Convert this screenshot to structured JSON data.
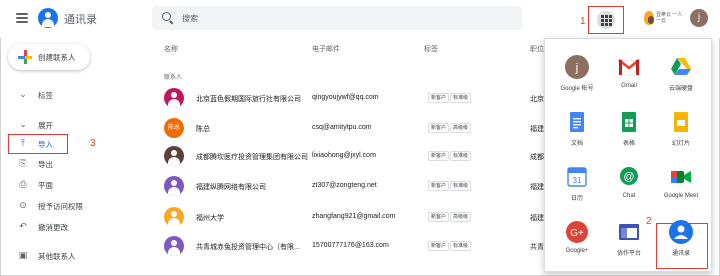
{
  "header": {
    "app_title": "通讯录",
    "search_placeholder": "搜索",
    "brand_text": "壹拳云 一人一云",
    "user_initial": "j",
    "steps": [
      "1",
      "2",
      "3"
    ]
  },
  "sidebar": {
    "create_label": "创建联系人",
    "items": [
      {
        "label": "标签",
        "icon": "chevron-down-icon"
      },
      {
        "label": "展开",
        "icon": "chevron-down-icon"
      },
      {
        "label": "导入",
        "icon": "upload-icon"
      },
      {
        "label": "导出",
        "icon": "download-icon"
      },
      {
        "label": "平面",
        "icon": "print-icon"
      },
      {
        "label": "授予访问权限",
        "icon": "delegate-icon"
      },
      {
        "label": "撤消更改",
        "icon": "undo-icon"
      },
      {
        "label": "其他联系人",
        "icon": "contacts-icon"
      }
    ]
  },
  "table": {
    "headers": [
      "名称",
      "电子邮件",
      "标签",
      "职位"
    ],
    "section_label": "联系人",
    "rows": [
      {
        "name": "北京蓝色假期国际旅行社有限公司",
        "email": "qingyoujywf@qq.com",
        "tags": [
          "新客户",
          "标准级"
        ],
        "job": "北京",
        "avatar_text": "",
        "avatar_color": "#c2185b"
      },
      {
        "name": "陈总",
        "email": "csq@amitytpu.com",
        "tags": [
          "新客户",
          "高级级"
        ],
        "job": "福建",
        "avatar_text": "陈总",
        "avatar_color": "#ef6c00"
      },
      {
        "name": "成都腾坎医疗投资管理集团有限公司",
        "email": "lixiaohong@jxyl.com",
        "tags": [
          "新客户",
          "标准级"
        ],
        "job": "成都",
        "avatar_text": "",
        "avatar_color": "#5d4037"
      },
      {
        "name": "福建纵腾网络有限公司",
        "email": "zt307@zongteng.net",
        "tags": [
          "新客户",
          "标准级"
        ],
        "job": "福建",
        "avatar_text": "",
        "avatar_color": "#7e57c2"
      },
      {
        "name": "福州大学",
        "email": "zhangfang921@gmail.com",
        "tags": [
          "新客户",
          "高级级"
        ],
        "job": "福建",
        "avatar_text": "",
        "avatar_color": "#f9a825"
      },
      {
        "name": "共青城赤兔投资管理中心（有限...",
        "email": "15700777176@163.com",
        "tags": [
          "新客户",
          "标准级"
        ],
        "job": "共青",
        "avatar_text": "",
        "avatar_color": "#7e57c2"
      }
    ]
  },
  "apps": [
    {
      "label": "Google 帐号",
      "icon": "google-account-icon"
    },
    {
      "label": "Gmail",
      "icon": "gmail-icon"
    },
    {
      "label": "云端硬盘",
      "icon": "drive-icon"
    },
    {
      "label": "文档",
      "icon": "docs-icon"
    },
    {
      "label": "表格",
      "icon": "sheets-icon"
    },
    {
      "label": "幻灯片",
      "icon": "slides-icon"
    },
    {
      "label": "日历",
      "icon": "calendar-icon"
    },
    {
      "label": "Chat",
      "icon": "chat-icon"
    },
    {
      "label": "Google Meet",
      "icon": "meet-icon"
    },
    {
      "label": "Google+",
      "icon": "google-plus-icon"
    },
    {
      "label": "协作平台",
      "icon": "sites-icon"
    },
    {
      "label": "通讯录",
      "icon": "contacts-icon"
    }
  ],
  "calendar_day": "31",
  "colors": {
    "accent": "#1a73e8",
    "highlight": "#e53935",
    "active": "#1967d2"
  }
}
